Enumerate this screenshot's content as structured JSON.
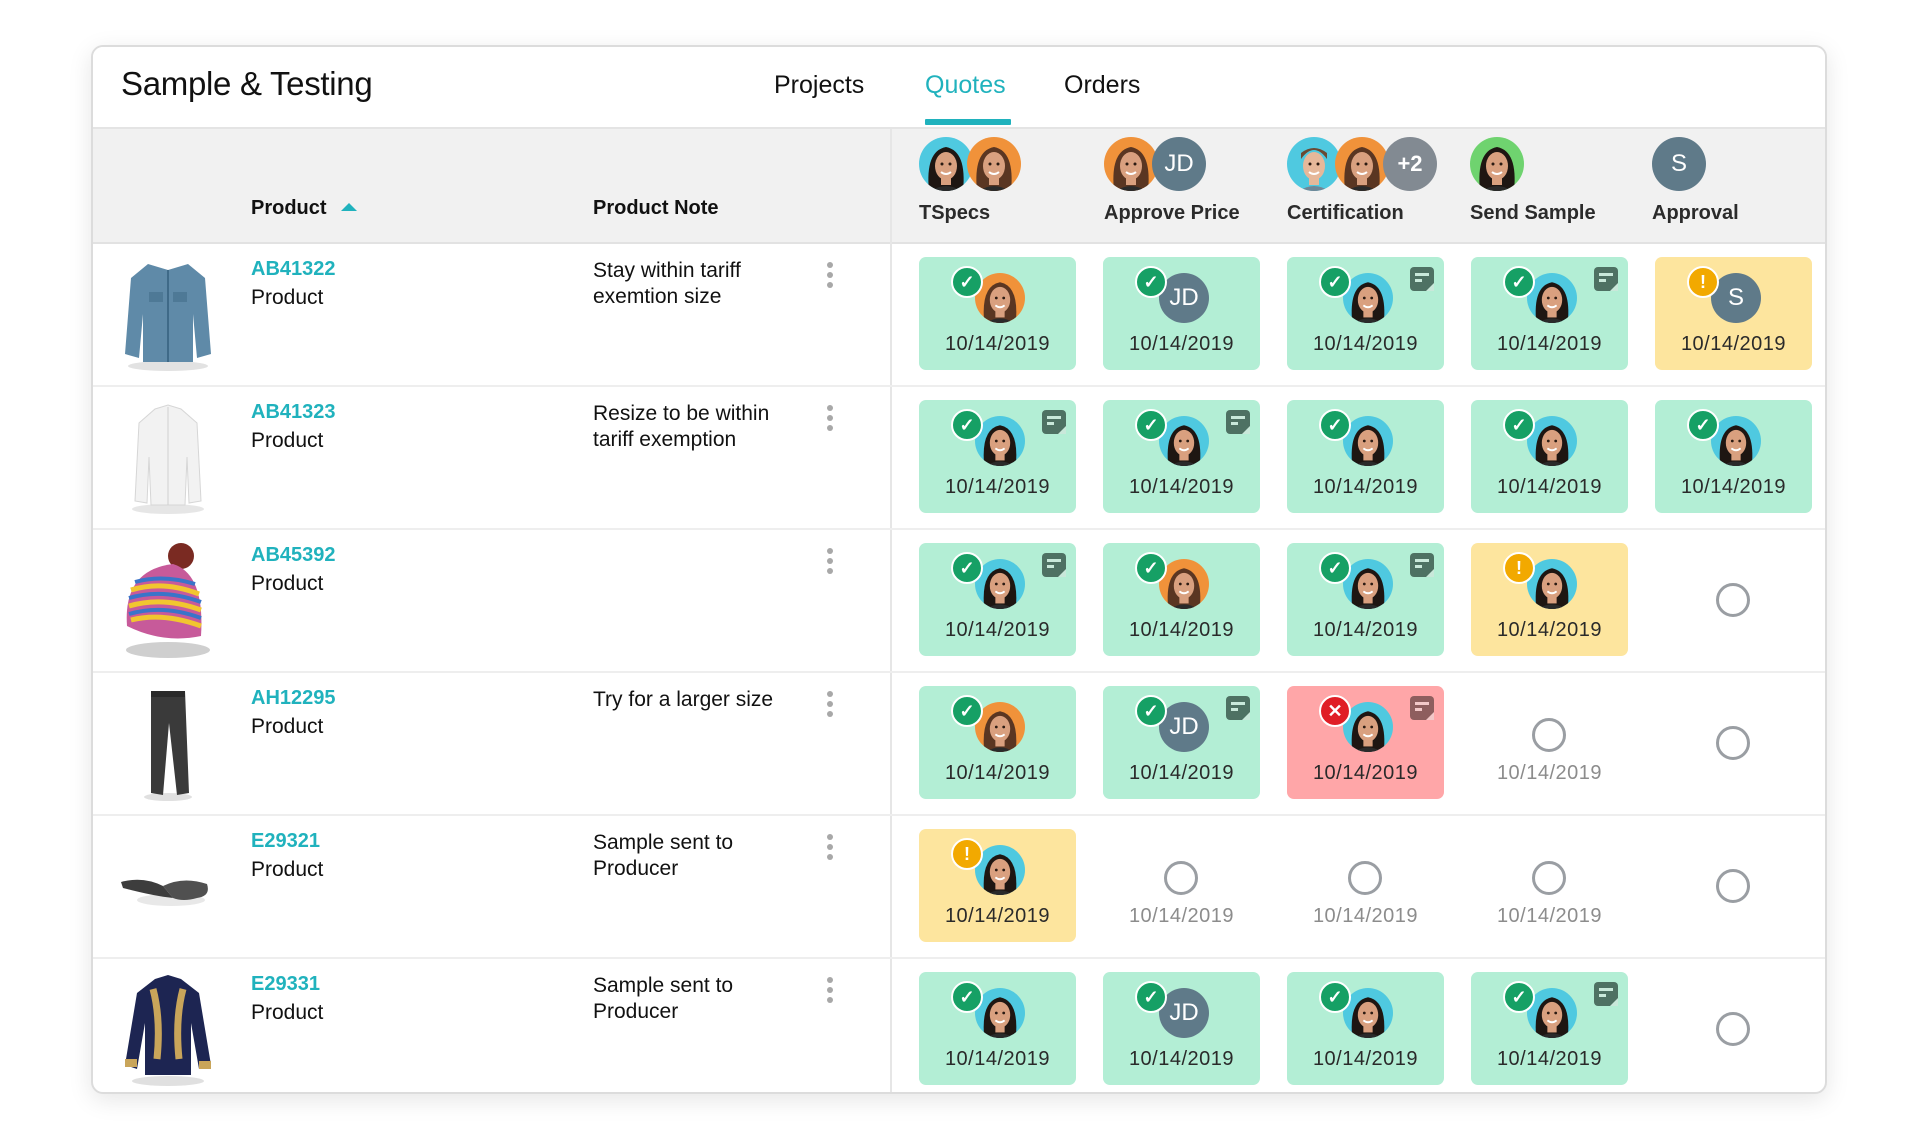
{
  "header": {
    "title": "Sample & Testing",
    "tabs": [
      {
        "label": "Projects",
        "active": false
      },
      {
        "label": "Quotes",
        "active": true
      },
      {
        "label": "Orders",
        "active": false
      }
    ]
  },
  "colors": {
    "accent": "#20b2bd",
    "done": "#b3eed5",
    "warning": "#fde59e",
    "failed": "#ffa6a8",
    "check_badge": "#16a065",
    "warning_badge": "#f2a900",
    "fail_badge": "#e01e26",
    "initials_avatar": "#5f7a89"
  },
  "table": {
    "columns": {
      "product": "Product",
      "product_note": "Product Note",
      "sort": "ascending"
    },
    "stages": [
      {
        "label": "TSpecs",
        "assignees": [
          {
            "type": "photo",
            "person": "woman-dark-hair",
            "ring": "#4fc9e0"
          },
          {
            "type": "photo",
            "person": "woman-brown-hair",
            "ring": "#f0923a"
          }
        ]
      },
      {
        "label": "Approve Price",
        "assignees": [
          {
            "type": "photo",
            "person": "woman-brown-hair",
            "ring": "#f0923a"
          },
          {
            "type": "initials",
            "text": "JD"
          }
        ]
      },
      {
        "label": "Certification",
        "assignees": [
          {
            "type": "photo",
            "person": "man",
            "ring": "#4fc9e0"
          },
          {
            "type": "photo",
            "person": "woman-brown-hair",
            "ring": "#f0923a"
          },
          {
            "type": "more",
            "text": "+2"
          }
        ]
      },
      {
        "label": "Send Sample",
        "assignees": [
          {
            "type": "photo",
            "person": "woman-dark-hair",
            "ring": "#6fd36f"
          }
        ]
      },
      {
        "label": "Approval",
        "assignees": [
          {
            "type": "initials",
            "text": "S"
          }
        ]
      }
    ],
    "rows": [
      {
        "id": "AB41322",
        "type": "Product",
        "note": "Stay within tariff exemtion size",
        "image": "denim-jacket",
        "cells": [
          {
            "status": "done",
            "date": "10/14/2019",
            "assignee": {
              "type": "photo",
              "person": "woman-brown-hair"
            },
            "note": false
          },
          {
            "status": "done",
            "date": "10/14/2019",
            "assignee": {
              "type": "initials",
              "text": "JD"
            },
            "note": false
          },
          {
            "status": "done",
            "date": "10/14/2019",
            "assignee": {
              "type": "photo",
              "person": "woman-dark-hair"
            },
            "note": true
          },
          {
            "status": "done",
            "date": "10/14/2019",
            "assignee": {
              "type": "photo",
              "person": "woman-dark-hair"
            },
            "note": true
          },
          {
            "status": "warning",
            "date": "10/14/2019",
            "assignee": {
              "type": "initials",
              "text": "S"
            },
            "note": false
          }
        ]
      },
      {
        "id": "AB41323",
        "type": "Product",
        "note": "Resize to be within tariff exemption",
        "image": "white-jacket",
        "cells": [
          {
            "status": "done",
            "date": "10/14/2019",
            "assignee": {
              "type": "photo",
              "person": "woman-dark-hair"
            },
            "note": true
          },
          {
            "status": "done",
            "date": "10/14/2019",
            "assignee": {
              "type": "photo",
              "person": "woman-dark-hair"
            },
            "note": true
          },
          {
            "status": "done",
            "date": "10/14/2019",
            "assignee": {
              "type": "photo",
              "person": "woman-dark-hair"
            },
            "note": false
          },
          {
            "status": "done",
            "date": "10/14/2019",
            "assignee": {
              "type": "photo",
              "person": "woman-dark-hair"
            },
            "note": false
          },
          {
            "status": "done",
            "date": "10/14/2019",
            "assignee": {
              "type": "photo",
              "person": "woman-dark-hair"
            },
            "note": false
          }
        ]
      },
      {
        "id": "AB45392",
        "type": "Product",
        "note": "",
        "image": "knit-beanie",
        "cells": [
          {
            "status": "done",
            "date": "10/14/2019",
            "assignee": {
              "type": "photo",
              "person": "woman-dark-hair"
            },
            "note": true
          },
          {
            "status": "done",
            "date": "10/14/2019",
            "assignee": {
              "type": "photo",
              "person": "woman-brown-hair"
            },
            "note": false
          },
          {
            "status": "done",
            "date": "10/14/2019",
            "assignee": {
              "type": "photo",
              "person": "woman-dark-hair"
            },
            "note": true
          },
          {
            "status": "warning",
            "date": "10/14/2019",
            "assignee": {
              "type": "photo",
              "person": "woman-dark-hair"
            },
            "note": false
          },
          {
            "status": "empty",
            "date": "",
            "assignee": null,
            "note": false
          }
        ]
      },
      {
        "id": "AH12295",
        "type": "Product",
        "note": "Try for a larger size",
        "image": "black-jeans",
        "cells": [
          {
            "status": "done",
            "date": "10/14/2019",
            "assignee": {
              "type": "photo",
              "person": "woman-brown-hair"
            },
            "note": false
          },
          {
            "status": "done",
            "date": "10/14/2019",
            "assignee": {
              "type": "initials",
              "text": "JD"
            },
            "note": true
          },
          {
            "status": "failed",
            "date": "10/14/2019",
            "assignee": {
              "type": "photo",
              "person": "woman-dark-hair"
            },
            "note": true
          },
          {
            "status": "pending",
            "date": "10/14/2019",
            "assignee": null,
            "note": false
          },
          {
            "status": "empty",
            "date": "",
            "assignee": null,
            "note": false
          }
        ]
      },
      {
        "id": "E29321",
        "type": "Product",
        "note": "Sample sent to Producer",
        "image": "grey-scarf",
        "cells": [
          {
            "status": "warning",
            "date": "10/14/2019",
            "assignee": {
              "type": "photo",
              "person": "woman-dark-hair"
            },
            "note": false
          },
          {
            "status": "pending",
            "date": "10/14/2019",
            "assignee": null,
            "note": false
          },
          {
            "status": "pending",
            "date": "10/14/2019",
            "assignee": null,
            "note": false
          },
          {
            "status": "pending",
            "date": "10/14/2019",
            "assignee": null,
            "note": false
          },
          {
            "status": "empty",
            "date": "",
            "assignee": null,
            "note": false
          }
        ]
      },
      {
        "id": "E29331",
        "type": "Product",
        "note": "Sample sent to Producer",
        "image": "embroidered-navy-shirt",
        "cells": [
          {
            "status": "done",
            "date": "10/14/2019",
            "assignee": {
              "type": "photo",
              "person": "woman-dark-hair"
            },
            "note": false
          },
          {
            "status": "done",
            "date": "10/14/2019",
            "assignee": {
              "type": "initials",
              "text": "JD"
            },
            "note": false
          },
          {
            "status": "done",
            "date": "10/14/2019",
            "assignee": {
              "type": "photo",
              "person": "woman-dark-hair"
            },
            "note": false
          },
          {
            "status": "done",
            "date": "10/14/2019",
            "assignee": {
              "type": "photo",
              "person": "woman-dark-hair"
            },
            "note": true
          },
          {
            "status": "empty",
            "date": "",
            "assignee": null,
            "note": false
          }
        ]
      }
    ]
  }
}
